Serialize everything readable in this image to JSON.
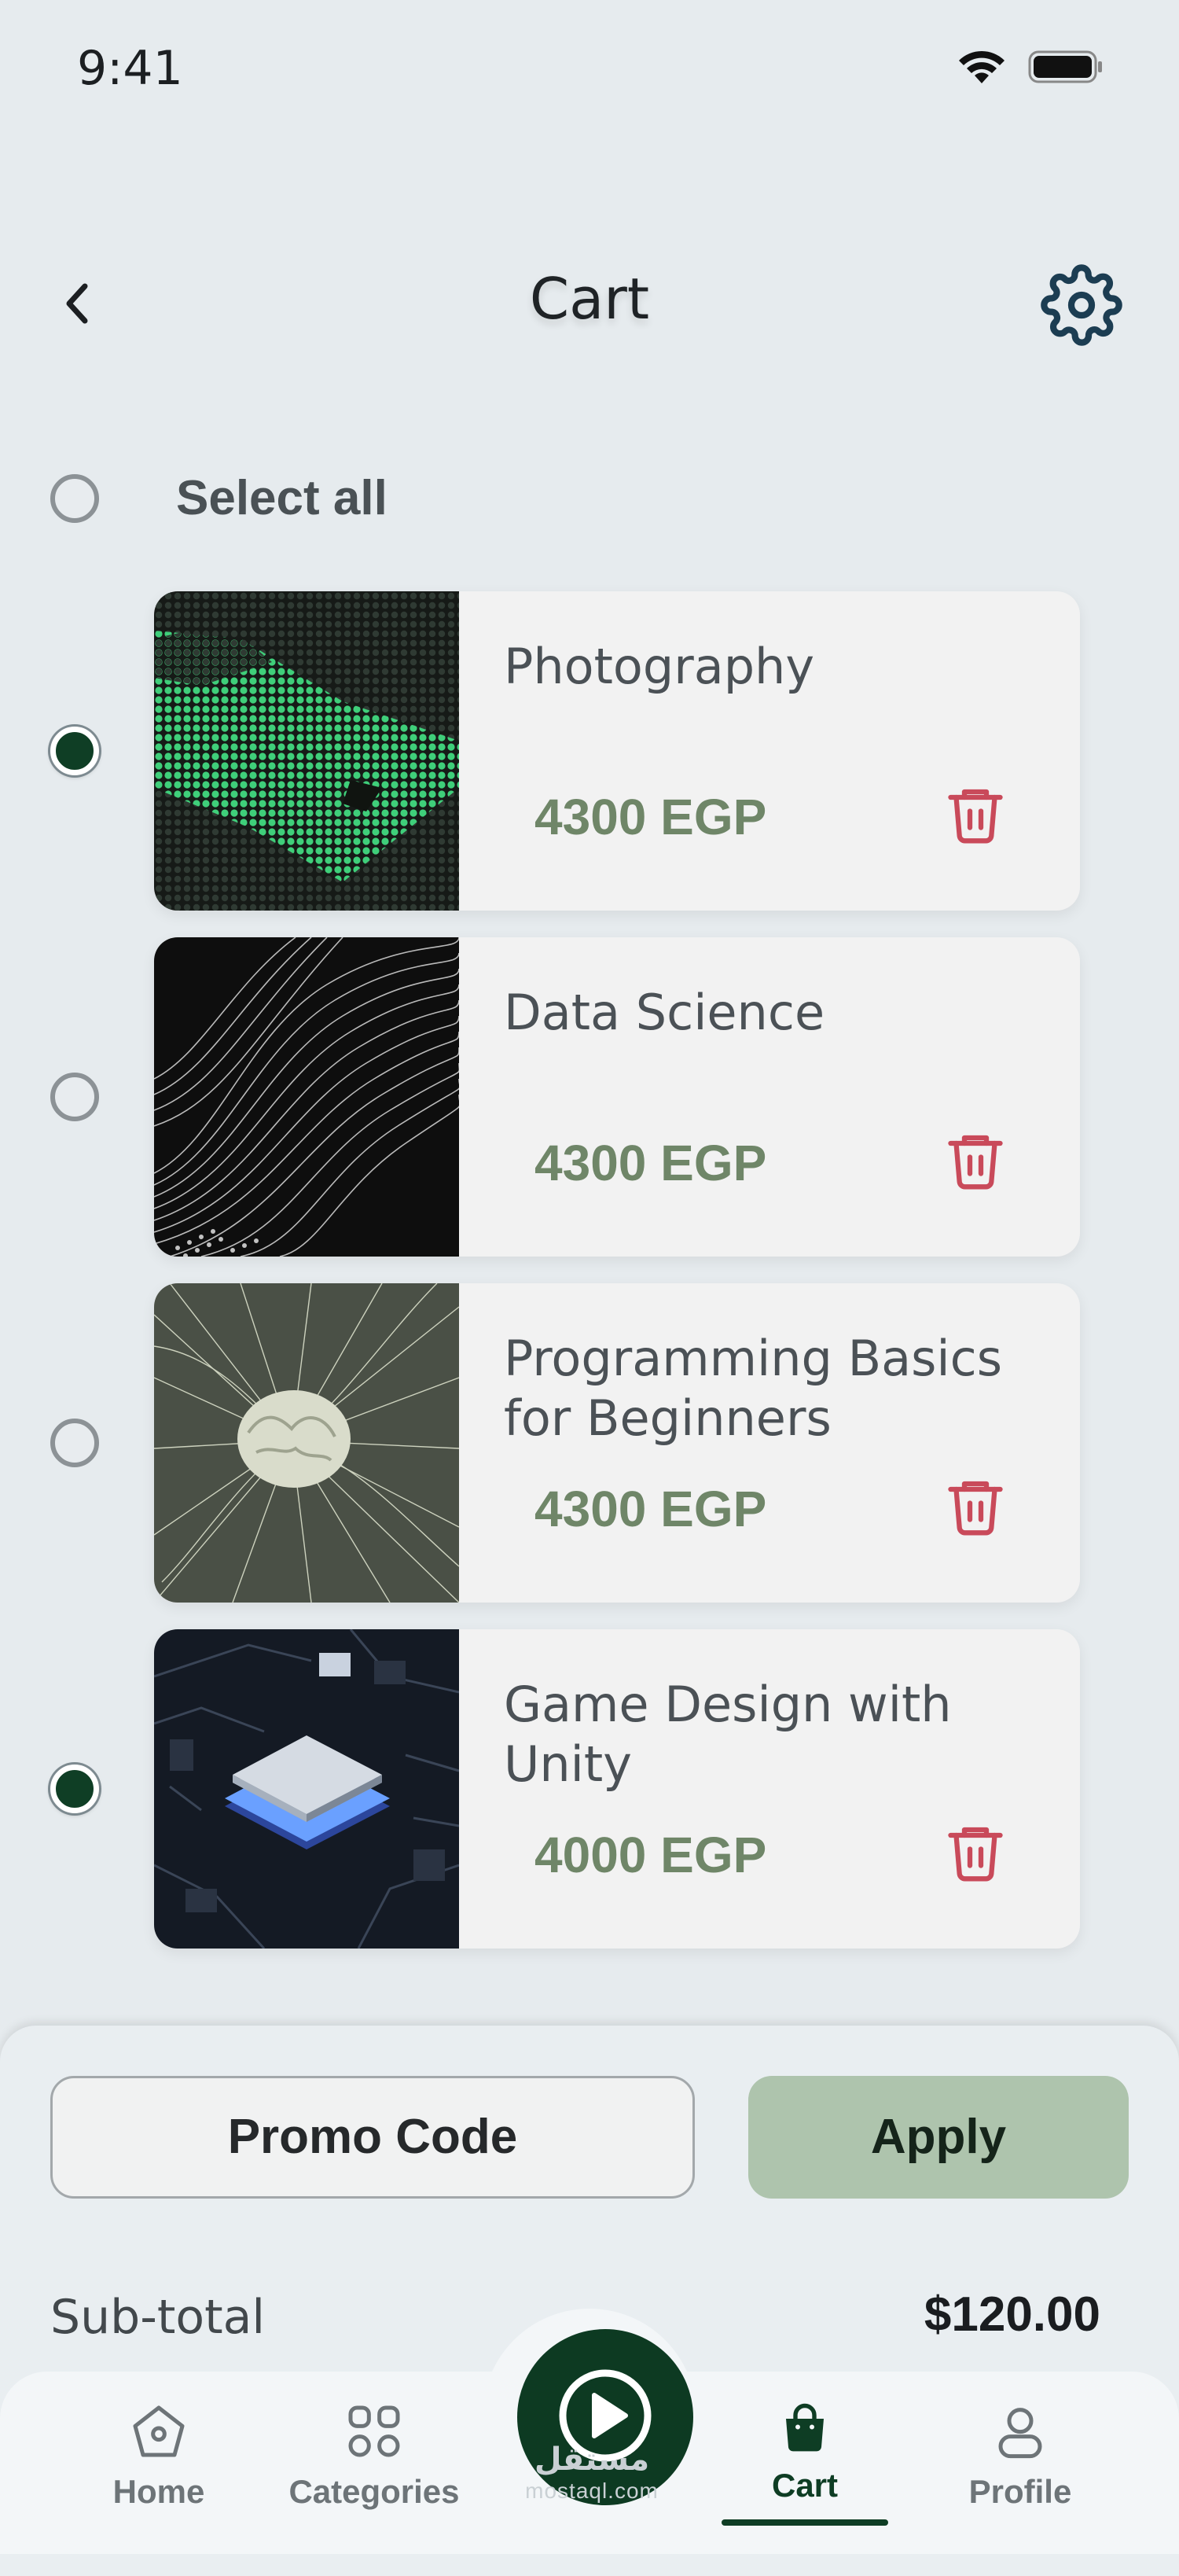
{
  "status_bar": {
    "time": "9:41",
    "wifi_icon": "wifi-icon",
    "battery_icon": "battery-icon"
  },
  "header": {
    "title": "Cart",
    "back_icon": "chevron-left-icon",
    "settings_icon": "gear-icon"
  },
  "select_all": {
    "label": "Select all",
    "checked": false
  },
  "items": [
    {
      "name": "Photography",
      "price": "4300 EGP",
      "selected": true,
      "thumbnail": "green-voxel-grid-image"
    },
    {
      "name": "Data Science",
      "price": "4300 EGP",
      "selected": false,
      "thumbnail": "monochrome-particle-wave-image"
    },
    {
      "name": "Programming Basics for Beginners",
      "price": "4300 EGP",
      "selected": false,
      "thumbnail": "brain-with-light-strands-image"
    },
    {
      "name": "Game Design with Unity",
      "price": "4000 EGP",
      "selected": true,
      "thumbnail": "glowing-microchip-image"
    }
  ],
  "promo": {
    "placeholder": "Promo Code",
    "apply_label": "Apply"
  },
  "summary": {
    "subtotal_label": "Sub-total",
    "subtotal_value": "$120.00"
  },
  "nav": {
    "items": [
      {
        "label": "Home",
        "icon": "home-icon"
      },
      {
        "label": "Categories",
        "icon": "grid-icon"
      },
      {
        "label": "Cart",
        "icon": "shopping-bag-icon",
        "active": true
      },
      {
        "label": "Profile",
        "icon": "person-icon"
      }
    ],
    "center_icon": "play-icon"
  },
  "watermark": {
    "arabic": "مستقل",
    "latin": "mostaql.com"
  },
  "colors": {
    "brand_dark_green": "#0d3a22",
    "price_green": "#6f8668",
    "apply_bg": "#aec4ad",
    "trash_red": "#c94a5a",
    "background": "#e6ebee"
  }
}
